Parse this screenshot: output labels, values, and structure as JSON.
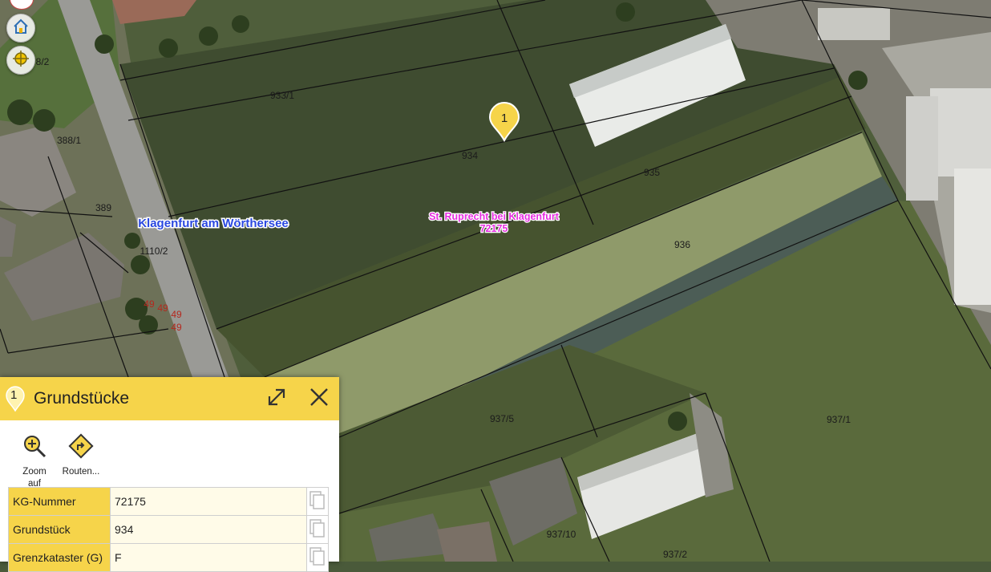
{
  "map": {
    "marker_number": "1",
    "place_labels": {
      "city": "Klagenfurt am Wörthersee",
      "cadastral_name": "St. Ruprecht bei Klagenfurt",
      "cadastral_number": "72175"
    },
    "parcels": {
      "p933_1": "933/1",
      "p934": "934",
      "p935": "935",
      "p936": "936",
      "p937_5": "937/5",
      "p937_1": "937/1",
      "p937_10": "937/10",
      "p937_2": "937/2",
      "p388_1": "388/1",
      "p389": "389",
      "p1110_2": "1110/2",
      "p8_2": "8/2",
      "n49a": "49",
      "n49b": "49",
      "n49c": "49",
      "n49d": "49"
    },
    "colors": {
      "city_label": "#2a48e0",
      "cadastral_label": "#e62ee0",
      "marker": "#f6d44a",
      "panel_accent": "#f6d44a"
    }
  },
  "controls": {
    "home_icon": "home-icon",
    "locate_icon": "crosshair-icon"
  },
  "panel": {
    "marker_number": "1",
    "title": "Grundstücke",
    "tools": [
      {
        "label": "Zoom auf",
        "icon": "zoom-in-icon"
      },
      {
        "label": "Routen...",
        "icon": "route-icon"
      }
    ],
    "rows": [
      {
        "key": "KG-Nummer",
        "value": "72175"
      },
      {
        "key": "Grundstück",
        "value": "934"
      },
      {
        "key": "Grenzkataster (G)",
        "value": "F"
      }
    ]
  }
}
